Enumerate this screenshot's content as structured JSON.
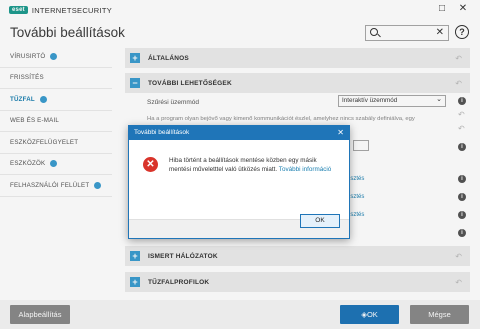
{
  "titlebar": {
    "logo": "eset",
    "app_name": "INTERNETSECURITY",
    "minimize": "□",
    "close": "✕"
  },
  "page": {
    "title": "További beállítások",
    "search_clear": "✕",
    "help": "?"
  },
  "sidebar": {
    "items": [
      {
        "label": "VÍRUSIRTÓ",
        "badge": true
      },
      {
        "label": "FRISSÍTÉS",
        "badge": false
      },
      {
        "label": "TŰZFAL",
        "badge": true,
        "active": true
      },
      {
        "label": "WEB ÉS E-MAIL",
        "badge": false
      },
      {
        "label": "ESZKÖZFELÜGYELET",
        "badge": false
      },
      {
        "label": "ESZKÖZÖK",
        "badge": true
      },
      {
        "label": "FELHASZNÁLÓI FELÜLET",
        "badge": true
      }
    ]
  },
  "sections": {
    "general": "ÁLTALÁNOS",
    "advanced": "TOVÁBBI LEHETŐSÉGEK",
    "known_networks": "ISMERT HÁLÓZATOK",
    "firewall_profiles": "TŰZFALPROFILOK",
    "expand_symbol": "+",
    "collapse_symbol": "−"
  },
  "settings": {
    "filter_mode_label": "Szűrési üzemmód",
    "filter_mode_value": "Interaktív üzemmód",
    "description": "Ha a program olyan bejövő vagy kimenő kommunikációt észlel, amelyhez nincs szabály definiálva, egy",
    "link_fragment": "esztés"
  },
  "dialog": {
    "title": "További beállítások",
    "message": "Hiba történt a beállítások mentése közben egy másik mentési műveletttel való ütközés miatt.",
    "link": "További információ",
    "ok": "OK",
    "close": "✕",
    "error_glyph": "✕"
  },
  "footer": {
    "default_button": "Alapbeállítás",
    "ok_button": "OK",
    "cancel_button": "Mégse"
  },
  "colors": {
    "accent": "#1f75b8",
    "teal": "#1f9c8f",
    "error": "#d9342b",
    "badge": "#3c9dd0"
  }
}
